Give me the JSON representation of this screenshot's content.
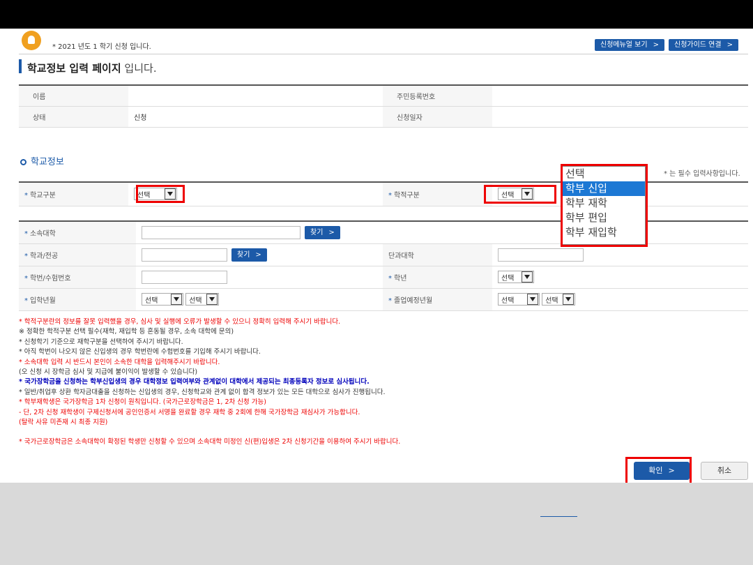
{
  "notice": "* 2021 년도 1 학기 신청 입니다.",
  "top_buttons": {
    "manual": "신청메뉴얼 보기",
    "guide": "신청가이드 연결",
    "chev": ">"
  },
  "page_title": {
    "main": "학교정보 입력 페이지",
    "suffix": " 입니다."
  },
  "applicant": {
    "name_label": "이름",
    "name_value": "",
    "ssn_label": "주민등록번호",
    "ssn_value": "",
    "status_label": "상태",
    "status_value": "신청",
    "date_label": "신청일자",
    "date_value": ""
  },
  "section_title": "학교정보",
  "required_note": "* 는 필수 입력사항입니다.",
  "school": {
    "school_type_label": "학교구분",
    "school_type_value": "선택",
    "academic_status_label": "학적구분",
    "academic_status_value": "선택",
    "university_label": "소속대학",
    "university_value": "",
    "find_label": "찾기",
    "major_label": "학과/전공",
    "major_value": "",
    "college_label": "단과대학",
    "college_value": "",
    "student_id_label": "학번/수험번호",
    "student_id_value": "",
    "grade_label": "학년",
    "grade_value": "선택",
    "admission_label": "입학년월",
    "admission_year": "선택",
    "admission_month": "선택",
    "graduation_label": "졸업예정년월",
    "graduation_year": "선택",
    "graduation_month": "선택"
  },
  "dropdown_options": [
    "선택",
    "학부 신입",
    "학부 재학",
    "학부 편입",
    "학부 재입학"
  ],
  "dropdown_selected": "학부 신입",
  "notes": [
    {
      "text": "* 학적구분란의 정보를 잘못 입력했을 경우, 심사 및 실행에 오류가 발생할 수 있으니 정확히 입력해 주시기 바랍니다.",
      "color": "red"
    },
    {
      "text": "※ 정확한 학적구분 선택 필수(재학, 재입학 등 혼동될 경우, 소속 대학에 문의)",
      "color": "default"
    },
    {
      "text": "* 신청학기 기준으로 재학구분을 선택하여 주시기 바랍니다.",
      "color": "default"
    },
    {
      "text": "* 아직 학번이 나오지 않은 신입생의 경우 학번란에 수험번호를 기입해 주시기 바랍니다.",
      "color": "default"
    },
    {
      "text": "* 소속대학 입력 시 반드시 본인이 소속한 대학을 입력해주시기 바랍니다.",
      "color": "red"
    },
    {
      "text": "  (오 신청 시 장학금 심사 및 지급에 불이익이 발생할 수 있습니다)",
      "color": "default"
    },
    {
      "text": "* 국가장학금을 신청하는 학부신입생의 경우 대학정보 입력여부와 관계없이 대학에서 제공되는 최종등록자 정보로 심사됩니다.",
      "color": "blue"
    },
    {
      "text": "* 일반/취업후 상환 학자금대출을 신청하는 신입생의 경우, 신청학교와 관계 없이 합격 정보가 있는 모든 대학으로 심사가 진행됩니다.",
      "color": "default"
    },
    {
      "text": "* 학부재학생은 국가장학금 1차 신청이 원칙입니다. (국가근로장학금은 1, 2차 신청 가능)",
      "color": "red"
    },
    {
      "text": "  - 단, 2차 신청 재학생이 구제신청서에 공인인증서 서명을 완료할 경우 재학 중 2회에 한해 국가장학금 재심사가 가능합니다.",
      "color": "red"
    },
    {
      "text": "    (탈락 사유 미존재 시 최종 지원)",
      "color": "red"
    },
    {
      "text": "* 국가근로장학금은 소속대학이 확정된 학생만 신청할 수 있으며 소속대학 미정인 신(편)입생은 2차 신청기간을 이용하여 주시기 바랍니다.",
      "color": "red"
    }
  ],
  "buttons": {
    "confirm": "확인",
    "cancel": "취소",
    "chev": ">"
  },
  "colors": {
    "primary": "#1c5aa8",
    "highlight": "#e00000",
    "dropdown_selected": "#1c78d4"
  }
}
